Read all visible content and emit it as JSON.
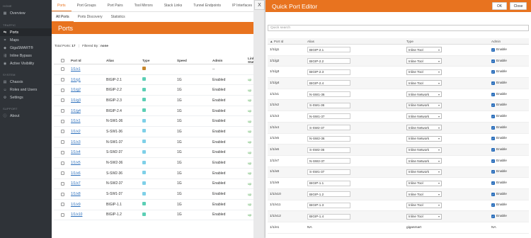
{
  "sidebar": {
    "sections": [
      {
        "heading": "HOME",
        "items": [
          {
            "label": "Overview",
            "icon": "dashboard-icon"
          }
        ]
      },
      {
        "heading": "TRAFFIC",
        "items": [
          {
            "label": "Ports",
            "icon": "ports-icon",
            "active": true
          },
          {
            "label": "Maps",
            "icon": "maps-icon"
          },
          {
            "label": "GigaSMART®",
            "icon": "gigasmart-icon"
          },
          {
            "label": "Inline Bypass",
            "icon": "inline-bypass-icon"
          },
          {
            "label": "Active Visibility",
            "icon": "active-visibility-icon"
          }
        ]
      },
      {
        "heading": "SYSTEM",
        "items": [
          {
            "label": "Chassis",
            "icon": "chassis-icon"
          },
          {
            "label": "Roles and Users",
            "icon": "users-icon"
          },
          {
            "label": "Settings",
            "icon": "gear-icon"
          }
        ]
      },
      {
        "heading": "SUPPORT",
        "items": [
          {
            "label": "About",
            "icon": "info-icon"
          }
        ]
      }
    ]
  },
  "topnav": [
    "Ports",
    "Port Groups",
    "Port Pairs",
    "Tool Mirrors",
    "Stack Links",
    "Tunnel Endpoints",
    "IP Interfaces"
  ],
  "subnav": [
    "All Ports",
    "Ports Discovery",
    "Statistics"
  ],
  "banner_title": "Ports",
  "meta": {
    "total_label": "Total Ports:",
    "total_value": "17",
    "filter_label": "Filtered By :",
    "filter_value": "none"
  },
  "ports_table": {
    "headers": [
      "Port Id",
      "Alias",
      "Type",
      "Speed",
      "Admin",
      "Link Status"
    ],
    "rows": [
      {
        "id": "1/1/x1",
        "alias": "",
        "type_color": "#c6862c",
        "speed": "",
        "admin": "--",
        "link": ""
      },
      {
        "id": "1/1/g1",
        "alias": "BIGIP-2.1",
        "type_color": "#5ccfb5",
        "speed": "1G",
        "admin": "Enabled",
        "link": "up"
      },
      {
        "id": "1/1/g2",
        "alias": "BIGIP-2.2",
        "type_color": "#5ccfb5",
        "speed": "1G",
        "admin": "Enabled",
        "link": "up"
      },
      {
        "id": "1/1/g3",
        "alias": "BIGIP-2.3",
        "type_color": "#5ccfb5",
        "speed": "1G",
        "admin": "Enabled",
        "link": "up"
      },
      {
        "id": "1/1/g4",
        "alias": "BIGIP-2.4",
        "type_color": "#5ccfb5",
        "speed": "1G",
        "admin": "Enabled",
        "link": "up"
      },
      {
        "id": "1/1/x1",
        "alias": "N-SW1-36",
        "type_color": "#7fd0e8",
        "speed": "1G",
        "admin": "Enabled",
        "link": "up"
      },
      {
        "id": "1/1/x2",
        "alias": "S-SW1-36",
        "type_color": "#7fd0e8",
        "speed": "1G",
        "admin": "Enabled",
        "link": "up"
      },
      {
        "id": "1/1/x3",
        "alias": "N-SW1-37",
        "type_color": "#7fd0e8",
        "speed": "1G",
        "admin": "Enabled",
        "link": "up"
      },
      {
        "id": "1/1/x4",
        "alias": "S-SW2-37",
        "type_color": "#7fd0e8",
        "speed": "1G",
        "admin": "Enabled",
        "link": "up"
      },
      {
        "id": "1/1/x5",
        "alias": "N-SW2-36",
        "type_color": "#7fd0e8",
        "speed": "1G",
        "admin": "Enabled",
        "link": "up"
      },
      {
        "id": "1/1/x6",
        "alias": "S-SW2-36",
        "type_color": "#7fd0e8",
        "speed": "1G",
        "admin": "Enabled",
        "link": "up"
      },
      {
        "id": "1/1/x7",
        "alias": "N-SW2-37",
        "type_color": "#7fd0e8",
        "speed": "1G",
        "admin": "Enabled",
        "link": "up"
      },
      {
        "id": "1/1/x8",
        "alias": "S-SW1-37",
        "type_color": "#7fd0e8",
        "speed": "1G",
        "admin": "Enabled",
        "link": "up"
      },
      {
        "id": "1/1/x9",
        "alias": "BIGIP-1.1",
        "type_color": "#5ccfb5",
        "speed": "1G",
        "admin": "Enabled",
        "link": "up"
      },
      {
        "id": "1/1/x10",
        "alias": "BIGIP-1.2",
        "type_color": "#5ccfb5",
        "speed": "1G",
        "admin": "Enabled",
        "link": "up"
      }
    ]
  },
  "close_x": "X",
  "editor": {
    "title": "Quick Port Editor",
    "ok_label": "OK",
    "close_label": "Close",
    "search_placeholder": "Quick search",
    "headers": [
      "Port Id",
      "Alias",
      "Type",
      "Admin"
    ],
    "rows": [
      {
        "id": "1/1/g1",
        "alias": "BIGIP-2.1",
        "type": "Inline Tool",
        "admin": "Enable",
        "editable": true
      },
      {
        "id": "1/1/g2",
        "alias": "BIGIP-2.2",
        "type": "Inline Tool",
        "admin": "Enable",
        "editable": true
      },
      {
        "id": "1/1/g3",
        "alias": "BIGIP-2.3",
        "type": "Inline Tool",
        "admin": "Enable",
        "editable": true
      },
      {
        "id": "1/1/g4",
        "alias": "BIGIP-2.4",
        "type": "Inline Tool",
        "admin": "Enable",
        "editable": true
      },
      {
        "id": "1/1/x1",
        "alias": "N-SW1-36",
        "type": "Inline Network",
        "admin": "Enable",
        "editable": true
      },
      {
        "id": "1/1/x2",
        "alias": "S-SW1-36",
        "type": "Inline Network",
        "admin": "Enable",
        "editable": true
      },
      {
        "id": "1/1/x3",
        "alias": "N-SW1-37",
        "type": "Inline Network",
        "admin": "Enable",
        "editable": true
      },
      {
        "id": "1/1/x4",
        "alias": "S-SW2-37",
        "type": "Inline Network",
        "admin": "Enable",
        "editable": true
      },
      {
        "id": "1/1/x5",
        "alias": "N-SW2-36",
        "type": "Inline Network",
        "admin": "Enable",
        "editable": true
      },
      {
        "id": "1/1/x6",
        "alias": "S-SW2-36",
        "type": "Inline Network",
        "admin": "Enable",
        "editable": true
      },
      {
        "id": "1/1/x7",
        "alias": "N-SW2-37",
        "type": "Inline Network",
        "admin": "Enable",
        "editable": true
      },
      {
        "id": "1/1/x8",
        "alias": "S-SW1-37",
        "type": "Inline Network",
        "admin": "Enable",
        "editable": true
      },
      {
        "id": "1/1/x9",
        "alias": "BIGIP-1.1",
        "type": "Inline Tool",
        "admin": "Enable",
        "editable": true
      },
      {
        "id": "1/1/x10",
        "alias": "BIGIP-1.2",
        "type": "Inline Tool",
        "admin": "Enable",
        "editable": true
      },
      {
        "id": "1/1/x11",
        "alias": "BIGIP-1.3",
        "type": "Inline Tool",
        "admin": "Enable",
        "editable": true
      },
      {
        "id": "1/1/x12",
        "alias": "BIGIP-1.4",
        "type": "Inline Tool",
        "admin": "Enable",
        "editable": true
      },
      {
        "id": "1/1/e1",
        "alias": "NA",
        "type": "gigasmart",
        "admin": "NA",
        "editable": false
      }
    ]
  },
  "colors": {
    "accent": "#e8731f",
    "sidebar_bg": "#2f3338",
    "link": "#2a6ebb"
  }
}
